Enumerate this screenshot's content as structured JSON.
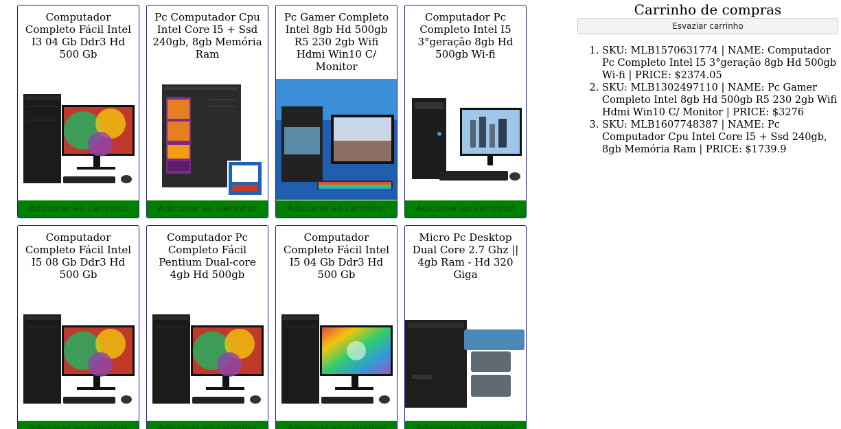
{
  "products": [
    {
      "title": "Computador Completo Fácil Intel I3 04 Gb Ddr3 Hd 500 Gb",
      "button_label": "Adicionar ao carrinho!",
      "image": "desktop-monitor-colorful"
    },
    {
      "title": "Pc Computador Cpu Intel Core I5 + Ssd 240gb, 8gb Memória Ram",
      "button_label": "Adicionar ao carrinho!",
      "image": "tower-with-spec-label"
    },
    {
      "title": "Pc Gamer Completo Intel 8gb Hd 500gb R5 230 2gb Wifi Hdmi Win10 C/ Monitor",
      "button_label": "Adicionar ao carrinho!",
      "image": "gamer-setup"
    },
    {
      "title": "Computador Pc Completo Intel I5 3°geração 8gb Hd 500gb Wi-fi",
      "button_label": "Adicionar ao carrinho!",
      "image": "desktop-monitor-city"
    },
    {
      "title": "Computador Completo Fácil Intel I5 08 Gb Ddr3 Hd 500 Gb",
      "button_label": "Adicionar ao carrinho!",
      "image": "desktop-monitor-colorful"
    },
    {
      "title": "Computador Pc Completo Fácil Pentium Dual-core 4gb Hd 500gb",
      "button_label": "Adicionar ao carrinho!",
      "image": "desktop-monitor-colorful"
    },
    {
      "title": "Computador Completo Fácil Intel I5 04 Gb Ddr3 Hd 500 Gb",
      "button_label": "Adicionar ao carrinho!",
      "image": "desktop-monitor-rainbow"
    },
    {
      "title": "Micro Pc Desktop Dual Core 2.7 Ghz || 4gb Ram - Hd 320 Giga",
      "button_label": "Adicionar ao carrinho!",
      "image": "tower-with-badges"
    }
  ],
  "cart": {
    "title": "Carrinho de compras",
    "empty_button_label": "Esvaziar carrinho",
    "items": [
      "SKU: MLB1570631774 | NAME: Computador Pc Completo Intel I5 3°geração 8gb Hd 500gb Wi-fi | PRICE: $2374.05",
      "SKU: MLB1302497110 | NAME: Pc Gamer Completo Intel 8gb Hd 500gb R5 230 2gb Wifi Hdmi Win10 C/ Monitor | PRICE: $3276",
      "SKU: MLB1607748387 | NAME: Pc Computador Cpu Intel Core I5 + Ssd 240gb, 8gb Memória Ram | PRICE: $1739.9"
    ]
  },
  "colors": {
    "card_border": "#1a1aa6",
    "add_button_bg": "#008000",
    "add_button_text": "#0b4f0b"
  }
}
